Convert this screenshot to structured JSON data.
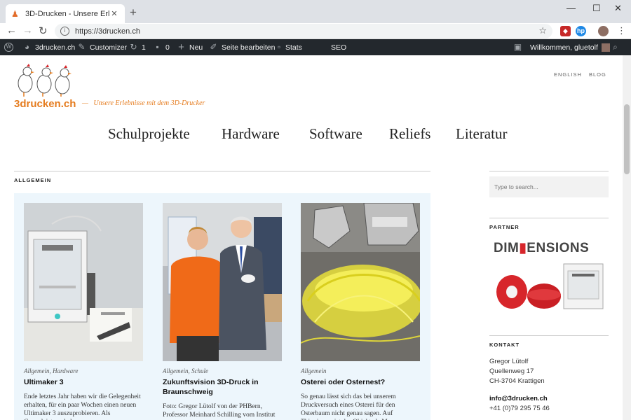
{
  "browser": {
    "tab_title": "3D-Drucken - Unsere Erlebnisse",
    "url": "https://3drucken.ch"
  },
  "wp_admin_bar": {
    "site": "3drucken.ch",
    "customizer": "Customizer",
    "updates": "1",
    "comments": "0",
    "new": "Neu",
    "edit": "Seite bearbeiten",
    "stats": "Stats",
    "seo": "SEO",
    "welcome": "Willkommen, gluetolf"
  },
  "site": {
    "title": "3drucken.ch",
    "separator": "—",
    "tagline": "Unsere Erlebnisse mit dem 3D-Drucker"
  },
  "top_nav": [
    "ENGLISH",
    "BLOG"
  ],
  "main_nav": [
    "Schulprojekte",
    "Hardware",
    "Software",
    "Reliefs",
    "Literatur"
  ],
  "section_label": "ALLGEMEIN",
  "posts": [
    {
      "categories": "Allgemein, Hardware",
      "title": "Ultimaker 3",
      "excerpt": "Ende letztes Jahr haben wir die Gelegenheit erhalten, für ein paar Wochen einen neuen Ultimaker 3 auszuprobieren. Als Gegenleistung haben"
    },
    {
      "categories": "Allgemein, Schule",
      "title": "Zukunftsvision 3D-Druck in Braunschweig",
      "excerpt": "Foto: Gregor Lütolf von der PHBern, Professor Meinhard Schilling vom Institut für Elektrische Messtechnik der TU"
    },
    {
      "categories": "Allgemein",
      "title": "Osterei oder Osternest?",
      "excerpt": "So genau lässt sich das bei unserem Druckversuch eines Osterei für den Osterbaum nicht genau sagen. Auf Thingiverse ist das Objekt als My"
    }
  ],
  "sidebar": {
    "search_placeholder": "Type to search...",
    "partner_label": "PARTNER",
    "partner_logo_a": "DIM",
    "partner_logo_b": "ENSIONS",
    "contact_label": "KONTAKT",
    "contact_name": "Gregor Lütolf",
    "contact_street": "Quellenweg 17",
    "contact_city": "CH-3704 Krattigen",
    "contact_email": "info@3drucken.ch",
    "contact_phone": "+41 (0)79 295 75 46"
  },
  "colors": {
    "accent": "#e57c1f",
    "admin_bar": "#23282d",
    "posts_bg": "#edf6fc"
  }
}
